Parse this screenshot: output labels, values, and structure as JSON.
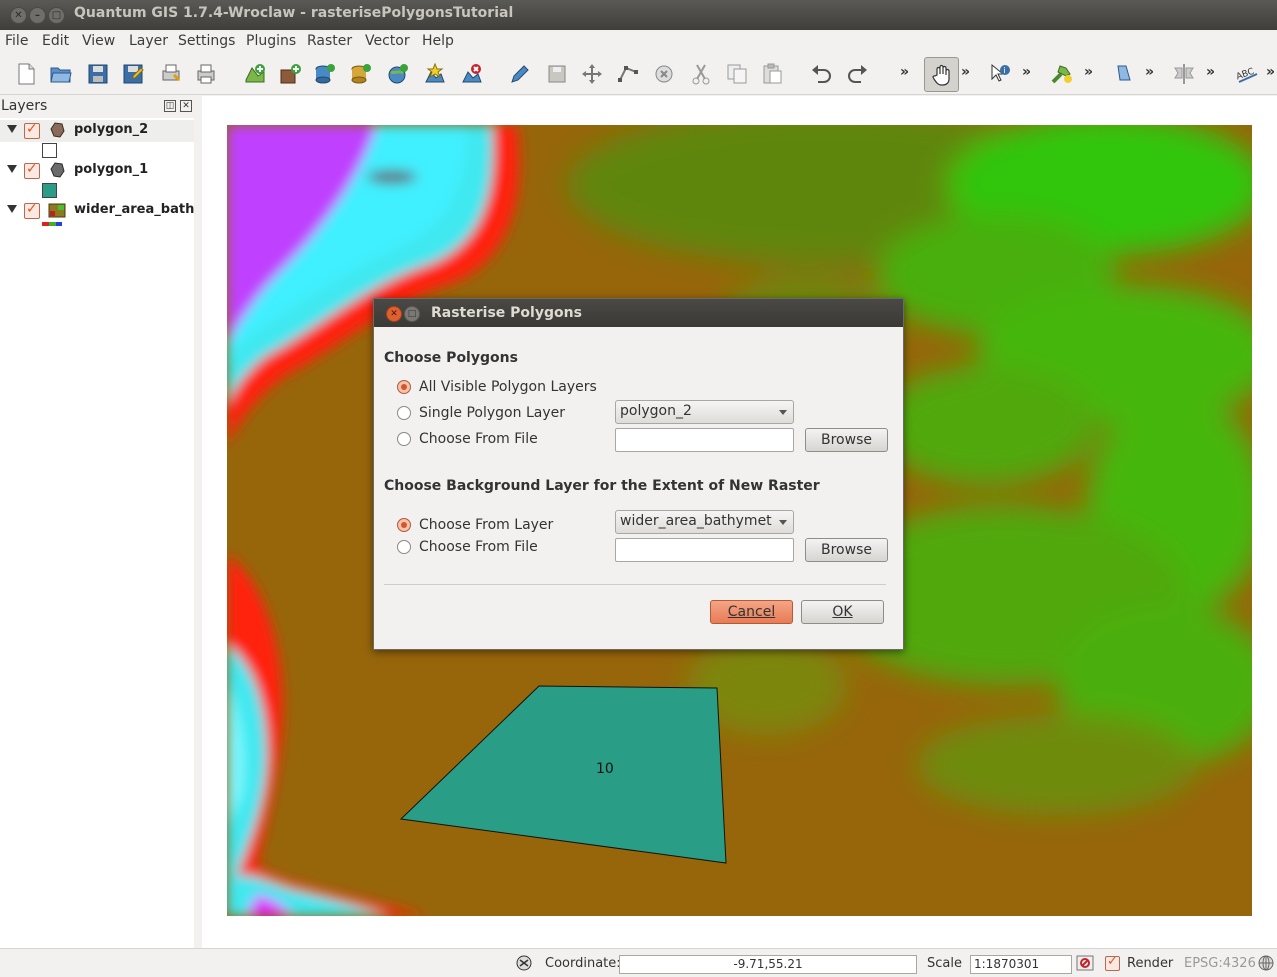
{
  "window": {
    "title": "Quantum GIS 1.7.4-Wroclaw - rasterisePolygonsTutorial"
  },
  "menubar": {
    "items": [
      {
        "label": "File",
        "mnemonic": "F"
      },
      {
        "label": "Edit",
        "mnemonic": "E"
      },
      {
        "label": "View",
        "mnemonic": "V"
      },
      {
        "label": "Layer",
        "mnemonic": "L"
      },
      {
        "label": "Settings",
        "mnemonic": "S"
      },
      {
        "label": "Plugins",
        "mnemonic": "P"
      },
      {
        "label": "Raster",
        "mnemonic": "R"
      },
      {
        "label": "Vector",
        "mnemonic": "V"
      },
      {
        "label": "Help",
        "mnemonic": "H"
      }
    ]
  },
  "toolbar": {
    "icons": [
      "new-project-icon",
      "open-project-icon",
      "save-project-icon",
      "save-as-icon",
      "print-composer-icon",
      "print-icon",
      "add-vector-layer-icon",
      "add-raster-layer-icon",
      "add-postgis-layer-icon",
      "add-spatialite-layer-icon",
      "add-wms-layer-icon",
      "new-shapefile-icon",
      "remove-layer-icon",
      "toggle-editing-icon",
      "save-edits-icon",
      "move-feature-icon",
      "node-tool-icon",
      "delete-selected-icon",
      "cut-features-icon",
      "copy-features-icon",
      "paste-features-icon",
      "undo-icon",
      "redo-icon",
      "pan-icon",
      "identify-icon",
      "plugin-icon",
      "measure-icon",
      "label-icon",
      "abc-label-icon"
    ],
    "overflow": "»"
  },
  "layers": {
    "title": "Layers",
    "items": [
      {
        "name": "polygon_2",
        "checked": true,
        "legend_color": "#ffffff"
      },
      {
        "name": "polygon_1",
        "checked": true,
        "legend_color": "#2a9d86"
      },
      {
        "name": "wider_area_bath…",
        "checked": true,
        "legend_color": "raster"
      }
    ]
  },
  "map": {
    "polygon_label": "10",
    "polygon_fill": "#2a9d86"
  },
  "dialog": {
    "title": "Rasterise Polygons",
    "section1": "Choose Polygons",
    "options1": [
      {
        "label": "All Visible Polygon Layers",
        "selected": true
      },
      {
        "label": "Single Polygon Layer",
        "selected": false
      },
      {
        "label": "Choose From File",
        "selected": false
      }
    ],
    "polygon_combo": "polygon_2",
    "file1_value": "",
    "browse1": "Browse",
    "section2": "Choose Background Layer for the Extent of New Raster",
    "options2": [
      {
        "label": "Choose From Layer",
        "selected": true
      },
      {
        "label": "Choose From File",
        "selected": false
      }
    ],
    "layer_combo": "wider_area_bathymetr",
    "file2_value": "",
    "browse2": "Browse",
    "cancel": "Cancel",
    "ok": "OK"
  },
  "statusbar": {
    "coordinate_label": "Coordinate:",
    "coordinate_value": "-9.71,55.21",
    "scale_label": "Scale",
    "scale_value": "1:1870301",
    "render_label": "Render",
    "render_checked": true,
    "crs": "EPSG:4326"
  },
  "colors": {
    "accent": "#e87b55",
    "titlebar": "#3f3e3a",
    "window_bg": "#f2f1f0"
  }
}
